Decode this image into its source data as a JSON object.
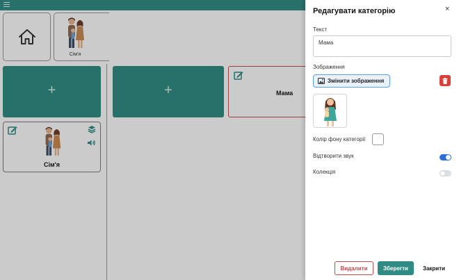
{
  "app": {
    "breadcrumb": {
      "family_label": "Сім'я"
    },
    "tiles": {
      "add_symbol": "+",
      "family_label": "Сім'я",
      "mama_label": "Мама"
    }
  },
  "panel": {
    "title": "Редагувати категорію",
    "close_symbol": "×",
    "text_label": "Текст",
    "text_value": "Мама",
    "image_label": "Зображення",
    "change_image_button": "Змінити зображення",
    "bg_color_label": "Колір фону категорії",
    "bg_color_value": "#ffffff",
    "play_sound_label": "Відтворити звук",
    "play_sound_on": true,
    "collection_label": "Колекція",
    "collection_on": false,
    "delete_button": "Видалити",
    "save_button": "Зберегти",
    "close_button": "Закрити"
  },
  "colors": {
    "accent": "#2f8b83",
    "danger": "#d9403a",
    "toggle_on": "#2b6fd6"
  }
}
